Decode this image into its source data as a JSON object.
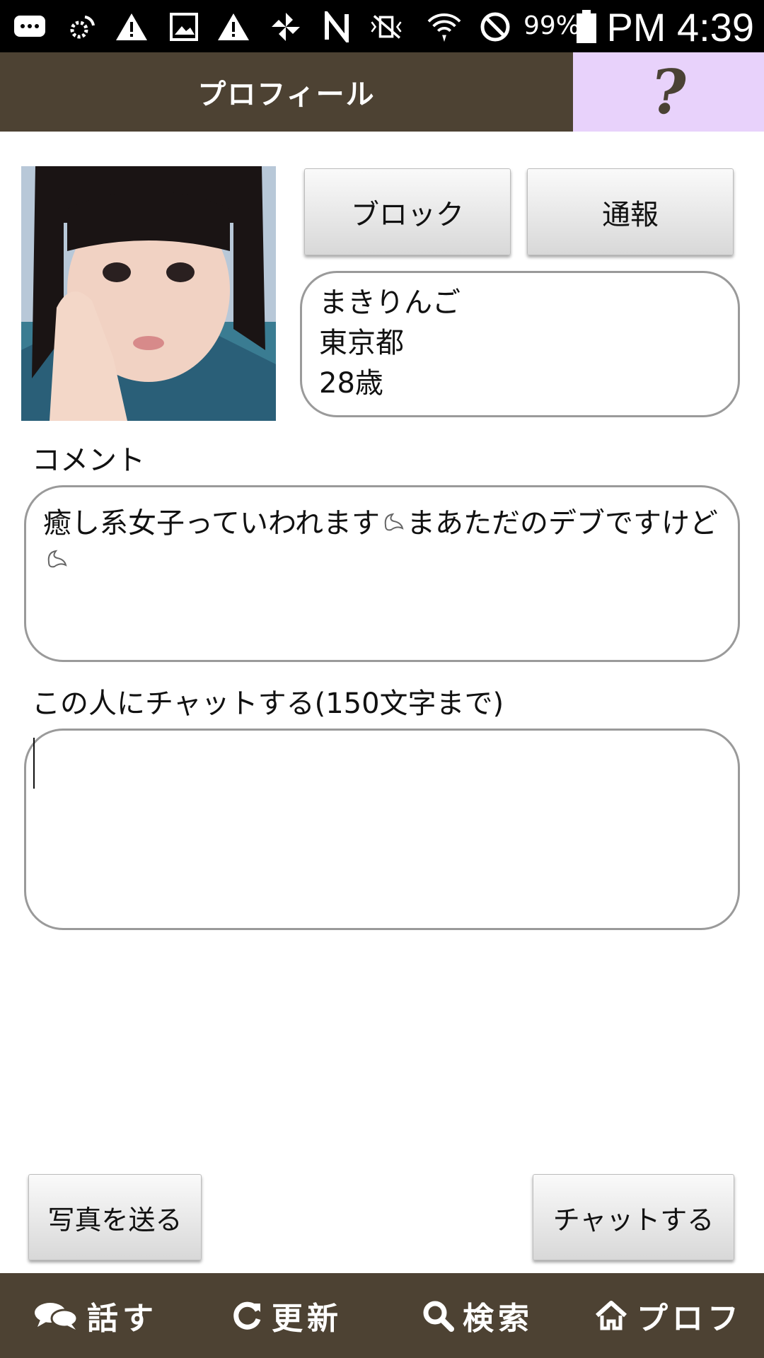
{
  "status_bar": {
    "battery_percent": "99%",
    "time": "PM 4:39"
  },
  "header": {
    "title": "プロフィール",
    "help_label": "?"
  },
  "profile": {
    "block_label": "ブロック",
    "report_label": "通報",
    "name": "まきりんご",
    "location": "東京都",
    "age": "28歳"
  },
  "comment": {
    "label": "コメント",
    "text_part1": "癒し系女子っていわれます",
    "text_part2": "まあただのデブですけど"
  },
  "chat": {
    "label": "この人にチャットする(150文字まで)",
    "input_value": ""
  },
  "actions": {
    "send_photo_label": "写真を送る",
    "chat_label": "チャットする"
  },
  "bottom_nav": {
    "items": [
      {
        "label": "話す",
        "icon": "speech-bubbles-icon"
      },
      {
        "label": "更新",
        "icon": "refresh-icon"
      },
      {
        "label": "検索",
        "icon": "search-icon"
      },
      {
        "label": "プロフ",
        "icon": "home-icon"
      }
    ]
  }
}
